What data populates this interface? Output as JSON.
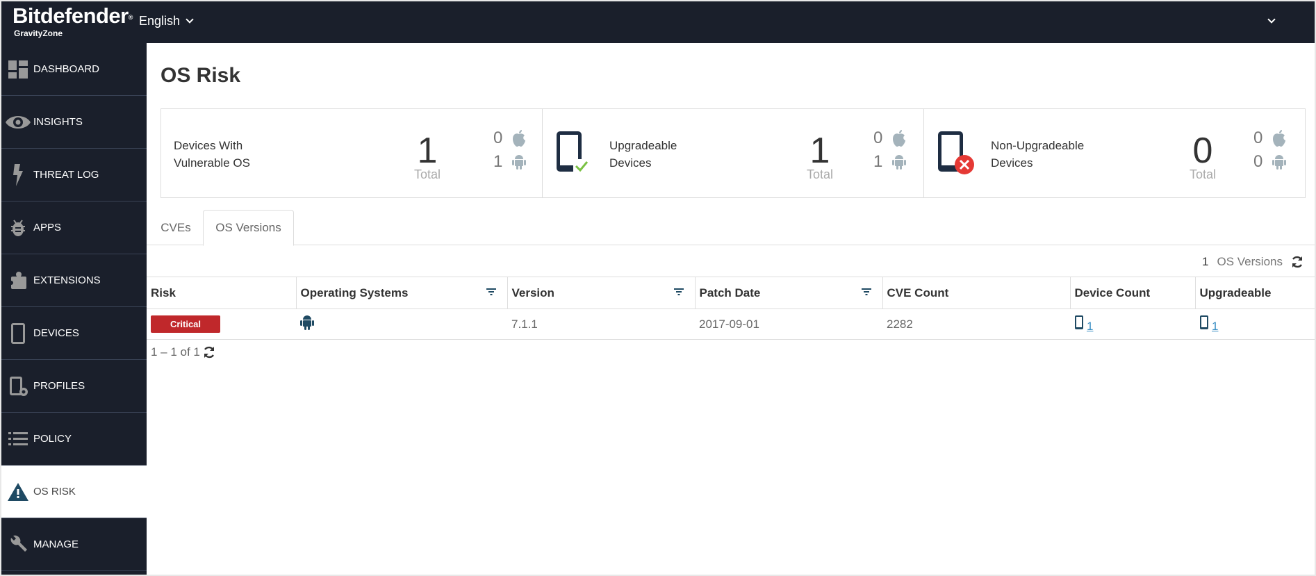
{
  "header": {
    "brand": "Bitdefender",
    "brand_sub": "GravityZone",
    "language": "English"
  },
  "sidebar": {
    "items": [
      {
        "label": "DASHBOARD",
        "icon": "dashboard-icon"
      },
      {
        "label": "INSIGHTS",
        "icon": "eye-icon"
      },
      {
        "label": "THREAT LOG",
        "icon": "lightning-icon"
      },
      {
        "label": "APPS",
        "icon": "bug-icon"
      },
      {
        "label": "EXTENSIONS",
        "icon": "puzzle-icon"
      },
      {
        "label": "DEVICES",
        "icon": "phone-icon"
      },
      {
        "label": "PROFILES",
        "icon": "phone-settings-icon"
      },
      {
        "label": "POLICY",
        "icon": "list-icon"
      },
      {
        "label": "OS RISK",
        "icon": "warning-icon",
        "active": true
      },
      {
        "label": "MANAGE",
        "icon": "wrench-icon"
      }
    ]
  },
  "page": {
    "title": "OS Risk"
  },
  "cards": [
    {
      "title_line1": "Devices With",
      "title_line2": "Vulnerable OS",
      "total": "1",
      "total_label": "Total",
      "ios": "0",
      "android": "1"
    },
    {
      "title_line1": "Upgradeable",
      "title_line2": "Devices",
      "total": "1",
      "total_label": "Total",
      "ios": "0",
      "android": "1"
    },
    {
      "title_line1": "Non-Upgradeable",
      "title_line2": "Devices",
      "total": "0",
      "total_label": "Total",
      "ios": "0",
      "android": "0"
    }
  ],
  "tabs": [
    {
      "label": "CVEs",
      "active": false
    },
    {
      "label": "OS Versions",
      "active": true
    }
  ],
  "summary": {
    "count": "1",
    "label": "OS Versions"
  },
  "table": {
    "columns": [
      "Risk",
      "Operating Systems",
      "Version",
      "Patch Date",
      "CVE Count",
      "Device Count",
      "Upgradeable"
    ],
    "rows": [
      {
        "risk": "Critical",
        "os": "android-icon",
        "version": "7.1.1",
        "patch_date": "2017-09-01",
        "cve_count": "2282",
        "device_count": "1",
        "upgradeable": "1"
      }
    ]
  },
  "pager": {
    "text": "1 – 1 of 1"
  },
  "colors": {
    "nav_bg": "#1a1f2b",
    "accent": "#1f4a63",
    "critical": "#c0282b",
    "success": "#7ac143",
    "danger": "#e53935"
  }
}
